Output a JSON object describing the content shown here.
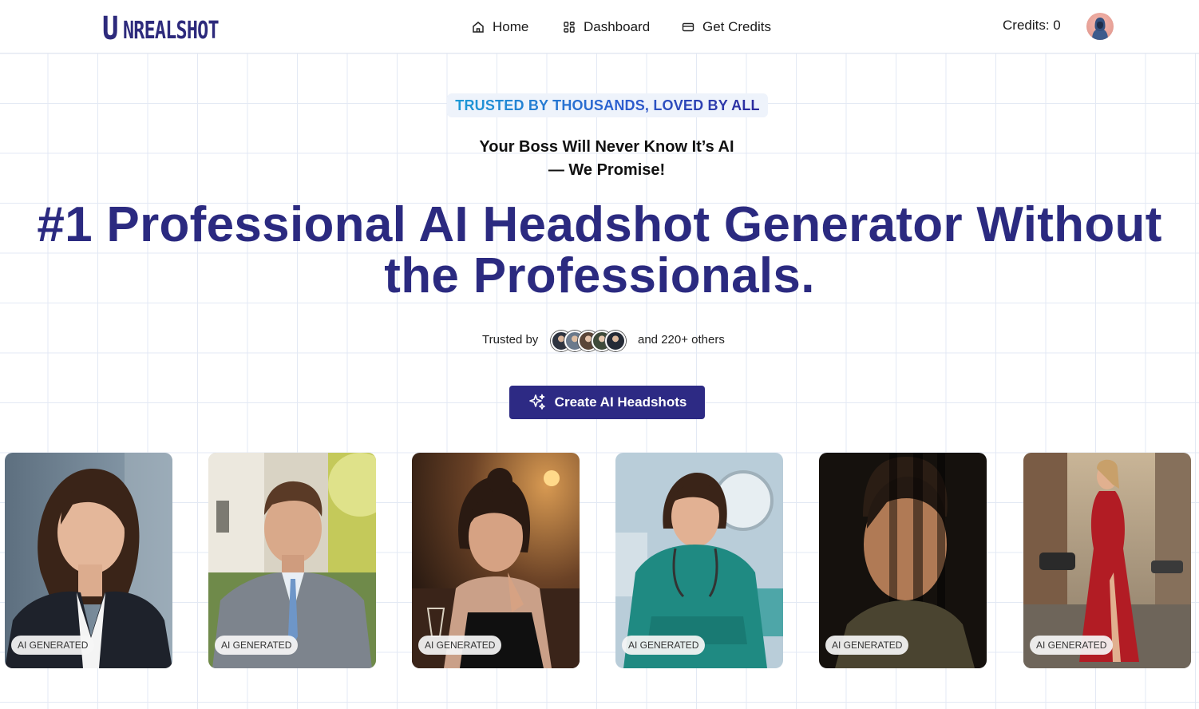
{
  "brand": {
    "logo_first": "U",
    "logo_rest": "NREALSHOT"
  },
  "nav": {
    "home": {
      "label": "Home",
      "icon": "home-icon"
    },
    "dashboard": {
      "label": "Dashboard",
      "icon": "dashboard-grid-icon"
    },
    "credits": {
      "label": "Get Credits",
      "icon": "credit-card-icon"
    }
  },
  "account": {
    "credits_text": "Credits: 0",
    "avatar_icon": "user-avatar"
  },
  "hero": {
    "badge": "TRUSTED BY THOUSANDS, LOVED BY ALL",
    "sub_line1": "Your Boss Will Never Know It’s AI",
    "sub_line2": "— We Promise!",
    "headline_line1": "#1 Professional AI Headshot Generator Without",
    "headline_line2": "the Professionals.",
    "trusted_by": "Trusted by",
    "others": "and 220+ others",
    "cta_label": "Create AI Headshots",
    "cta_icon": "sparkles-icon"
  },
  "gallery": {
    "tag": "AI GENERATED",
    "items": [
      {
        "subject": "woman-business-suit"
      },
      {
        "subject": "man-grey-suit"
      },
      {
        "subject": "woman-evening-restaurant"
      },
      {
        "subject": "woman-nurse-scrubs"
      },
      {
        "subject": "man-dramatic-shadow"
      },
      {
        "subject": "woman-red-dress-street"
      }
    ]
  },
  "colors": {
    "brand": "#2d2a7c",
    "cta": "#2d2a84",
    "grid": "#e3e9f4",
    "badge_bg": "#eef3fb"
  }
}
